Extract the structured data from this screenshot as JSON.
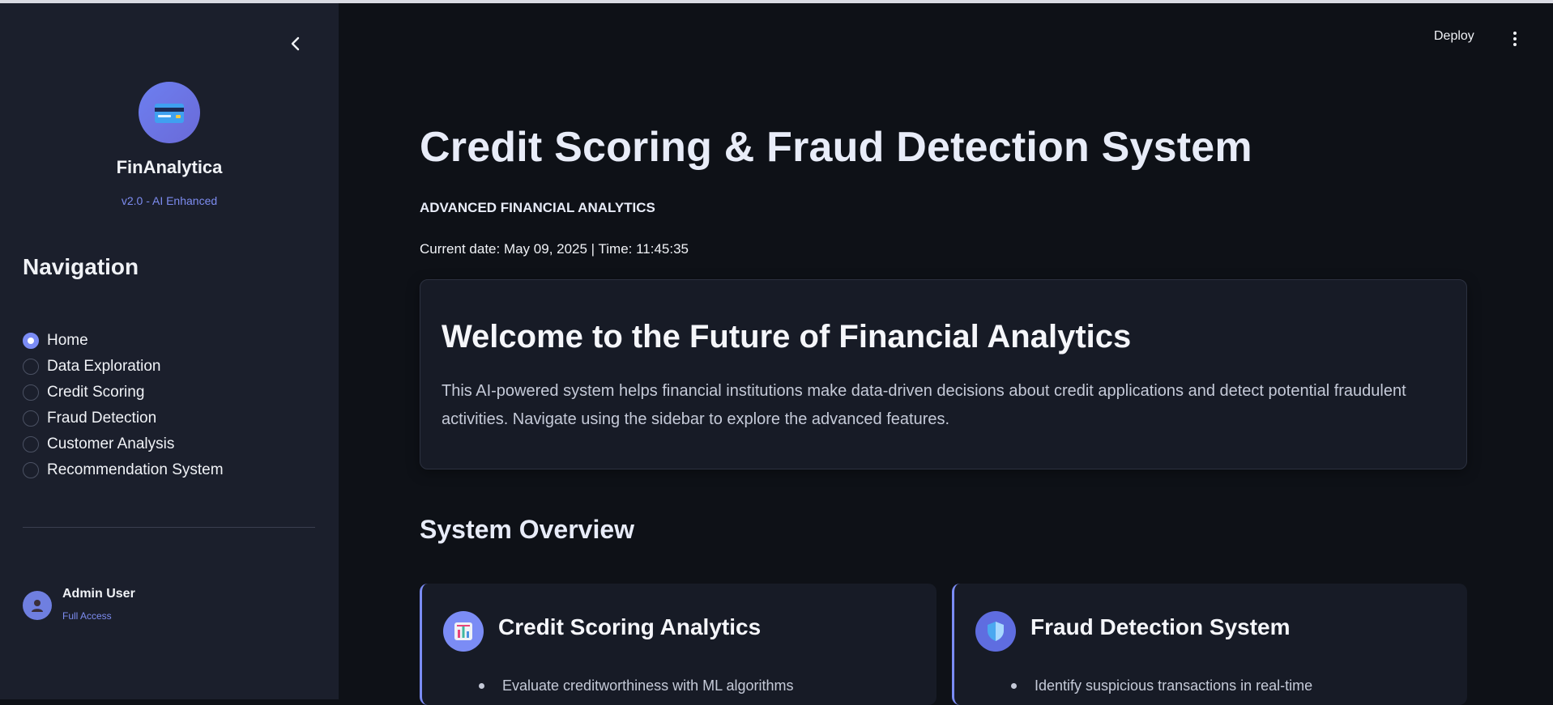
{
  "sidebar": {
    "brand_name": "FinAnalytica",
    "brand_version": "v2.0 - AI Enhanced",
    "logo_icon": "credit-card-icon",
    "nav_heading": "Navigation",
    "nav_items": [
      {
        "label": "Home",
        "selected": true
      },
      {
        "label": "Data Exploration",
        "selected": false
      },
      {
        "label": "Credit Scoring",
        "selected": false
      },
      {
        "label": "Fraud Detection",
        "selected": false
      },
      {
        "label": "Customer Analysis",
        "selected": false
      },
      {
        "label": "Recommendation System",
        "selected": false
      }
    ],
    "user": {
      "name": "Admin User",
      "role": "Full Access",
      "avatar_icon": "user-icon"
    }
  },
  "header": {
    "deploy_label": "Deploy",
    "menu_icon": "more-vertical-icon"
  },
  "main": {
    "title": "Credit Scoring & Fraud Detection System",
    "subtitle": "ADVANCED FINANCIAL ANALYTICS",
    "datetime": "Current date: May 09, 2025 | Time: 11:45:35",
    "welcome": {
      "title": "Welcome to the Future of Financial Analytics",
      "text": "This AI-powered system helps financial institutions make data-driven decisions about credit applications and detect potential fraudulent activities. Navigate using the sidebar to explore the advanced features."
    },
    "overview_title": "System Overview",
    "features": [
      {
        "title": "Credit Scoring Analytics",
        "icon": "bar-chart-icon",
        "bullet": "Evaluate creditworthiness with ML algorithms"
      },
      {
        "title": "Fraud Detection System",
        "icon": "shield-icon",
        "bullet": "Identify suspicious transactions in real-time"
      }
    ]
  },
  "colors": {
    "background": "#0e1117",
    "sidebar": "#1b1f2c",
    "accent": "#7b8cf5",
    "card": "#171b26"
  }
}
